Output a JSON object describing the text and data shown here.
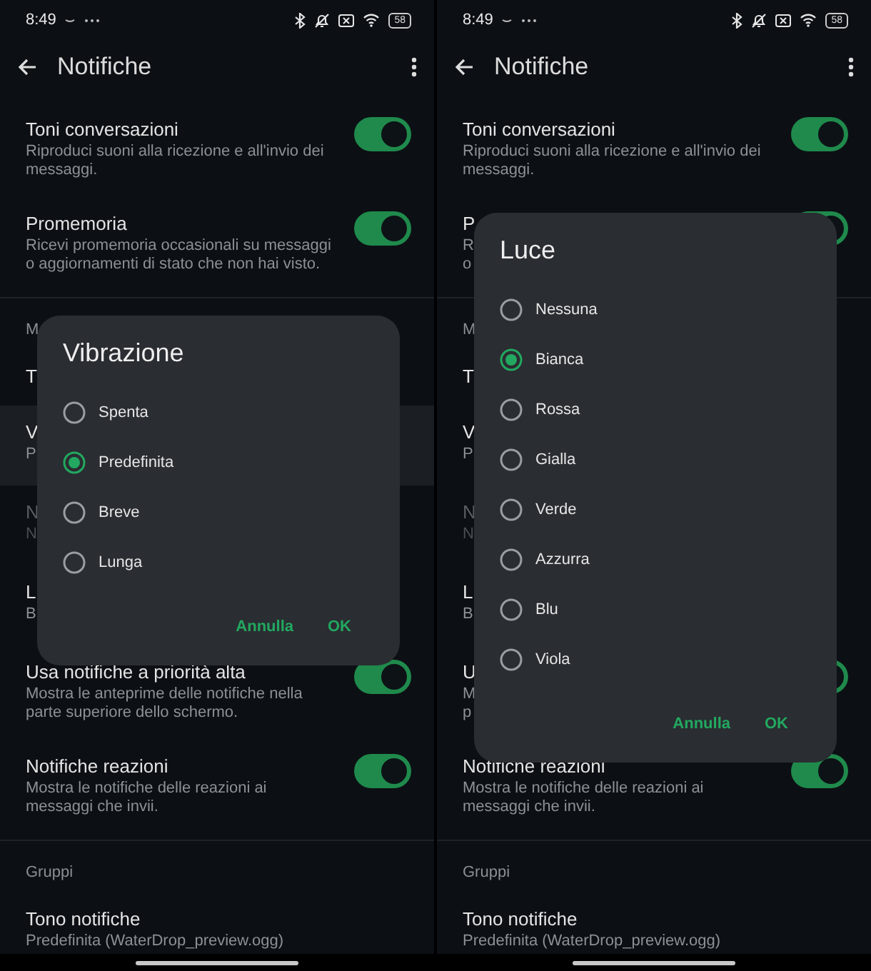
{
  "screens": [
    {
      "status_bar": {
        "time": "8:49",
        "battery": "58"
      },
      "toolbar": {
        "title": "Notifiche"
      },
      "items": [
        {
          "kind": "toggle",
          "title": "Toni conversazioni",
          "description": [
            "Riproduci suoni alla ricezione e all'invio dei",
            "messaggi."
          ],
          "on": true
        },
        {
          "kind": "toggle",
          "title": "Promemoria",
          "description": [
            "Ricevi promemoria occasionali su messaggi",
            "o aggiornamenti di stato che non hai visto."
          ],
          "on": true
        },
        {
          "kind": "section",
          "label": "M"
        },
        {
          "kind": "setting",
          "title": "T",
          "highlighted": false,
          "disabled": false
        },
        {
          "kind": "setting",
          "title": "V",
          "description": [
            "P"
          ],
          "highlighted": true,
          "disabled": false
        },
        {
          "kind": "setting",
          "title": "N",
          "description": [
            "N"
          ],
          "highlighted": false,
          "disabled": true
        },
        {
          "kind": "setting",
          "title": "L",
          "description": [
            "B"
          ],
          "highlighted": false,
          "disabled": false
        },
        {
          "kind": "toggle",
          "title": "Usa notifiche a priorità alta",
          "description": [
            "Mostra le anteprime delle notifiche nella",
            "parte superiore dello schermo."
          ],
          "on": true
        },
        {
          "kind": "toggle",
          "title": "Notifiche reazioni",
          "description": [
            "Mostra le notifiche delle reazioni ai",
            "messaggi che invii."
          ],
          "on": true
        },
        {
          "kind": "section",
          "label": "Gruppi"
        },
        {
          "kind": "setting",
          "title": "Tono notifiche",
          "description": [
            "Predefinita (WaterDrop_preview.ogg)"
          ],
          "highlighted": false,
          "disabled": false
        }
      ],
      "dialog": {
        "title": "Vibrazione",
        "options": [
          {
            "label": "Spenta",
            "selected": false
          },
          {
            "label": "Predefinita",
            "selected": true
          },
          {
            "label": "Breve",
            "selected": false
          },
          {
            "label": "Lunga",
            "selected": false
          }
        ],
        "buttons": [
          "Annulla",
          "OK"
        ]
      }
    },
    {
      "status_bar": {
        "time": "8:49",
        "battery": "58"
      },
      "toolbar": {
        "title": "Notifiche"
      },
      "items": [
        {
          "kind": "toggle",
          "title": "Toni conversazioni",
          "description": [
            "Riproduci suoni alla ricezione e all'invio dei",
            "messaggi."
          ],
          "on": true
        },
        {
          "kind": "toggle",
          "title": "P",
          "description": [
            "R",
            "o"
          ],
          "on": true
        },
        {
          "kind": "section",
          "label": "M"
        },
        {
          "kind": "setting",
          "title": "T",
          "highlighted": false,
          "disabled": false
        },
        {
          "kind": "setting",
          "title": "V",
          "description": [
            "P"
          ],
          "highlighted": false,
          "disabled": false
        },
        {
          "kind": "setting",
          "title": "N",
          "description": [
            "N"
          ],
          "highlighted": false,
          "disabled": true
        },
        {
          "kind": "setting",
          "title": "L",
          "description": [
            "B"
          ],
          "highlighted": false,
          "disabled": false
        },
        {
          "kind": "toggle",
          "title": "U",
          "description": [
            "M",
            "p"
          ],
          "on": true
        },
        {
          "kind": "toggle",
          "title": "Notifiche reazioni",
          "description": [
            "Mostra le notifiche delle reazioni ai",
            "messaggi che invii."
          ],
          "on": true
        },
        {
          "kind": "section",
          "label": "Gruppi"
        },
        {
          "kind": "setting",
          "title": "Tono notifiche",
          "description": [
            "Predefinita (WaterDrop_preview.ogg)"
          ],
          "highlighted": false,
          "disabled": false
        }
      ],
      "dialog": {
        "title": "Luce",
        "options": [
          {
            "label": "Nessuna",
            "selected": false
          },
          {
            "label": "Bianca",
            "selected": true
          },
          {
            "label": "Rossa",
            "selected": false
          },
          {
            "label": "Gialla",
            "selected": false
          },
          {
            "label": "Verde",
            "selected": false
          },
          {
            "label": "Azzurra",
            "selected": false
          },
          {
            "label": "Blu",
            "selected": false
          },
          {
            "label": "Viola",
            "selected": false
          }
        ],
        "buttons": [
          "Annulla",
          "OK"
        ]
      }
    }
  ]
}
